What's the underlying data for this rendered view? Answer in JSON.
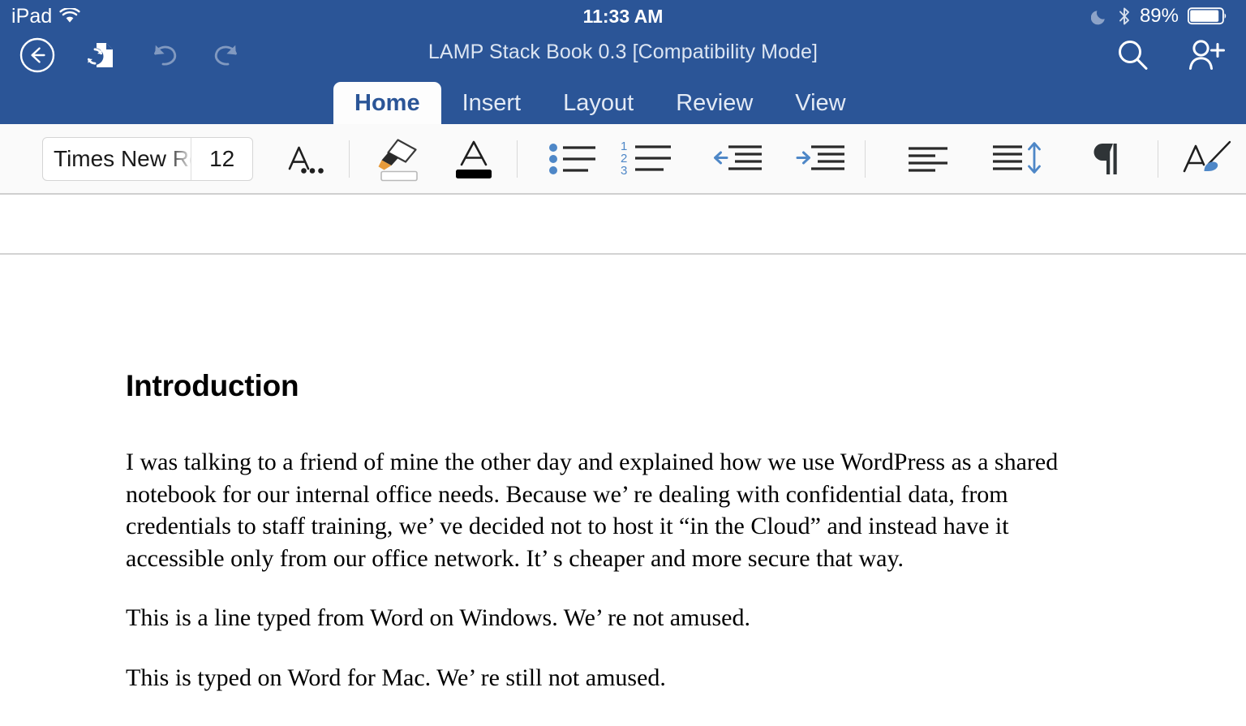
{
  "status_bar": {
    "device_label": "iPad",
    "wifi_icon": "wifi-icon",
    "time": "11:33 AM",
    "dnd_icon": "moon-icon",
    "bluetooth_icon": "bluetooth-icon",
    "battery_percent": "89%",
    "battery_icon": "battery-icon"
  },
  "title_bar": {
    "document_title": "LAMP Stack Book 0.3 [Compatibility Mode]",
    "left_buttons": [
      {
        "name": "back-button",
        "icon": "back-arrow-circle-icon",
        "enabled": true
      },
      {
        "name": "save-sync-button",
        "icon": "file-sync-icon",
        "enabled": true
      },
      {
        "name": "undo-button",
        "icon": "undo-arrow-icon",
        "enabled": false
      },
      {
        "name": "redo-button",
        "icon": "redo-arrow-icon",
        "enabled": false
      }
    ],
    "right_buttons": [
      {
        "name": "search-button",
        "icon": "search-icon"
      },
      {
        "name": "share-invite-button",
        "icon": "add-person-icon"
      }
    ],
    "colors": {
      "header_blue": "#2B5597",
      "title_text": "#DCE5F2"
    }
  },
  "tabs": {
    "active": "Home",
    "items": [
      {
        "label": "Home"
      },
      {
        "label": "Insert"
      },
      {
        "label": "Layout"
      },
      {
        "label": "Review"
      },
      {
        "label": "View"
      }
    ]
  },
  "ribbon": {
    "font_name": "Times New Ro",
    "font_size": "12",
    "buttons": [
      {
        "name": "font-formatting-button",
        "icon": "font-format-a-ellipsis-icon"
      },
      {
        "name": "highlight-color-button",
        "icon": "highlighter-pen-icon",
        "swatch": "#FFFFFF"
      },
      {
        "name": "font-color-button",
        "icon": "font-color-a-icon",
        "swatch": "#000000"
      },
      {
        "name": "bulleted-list-button",
        "icon": "bullet-list-icon"
      },
      {
        "name": "numbered-list-button",
        "icon": "numbered-list-icon"
      },
      {
        "name": "decrease-indent-button",
        "icon": "decrease-indent-icon"
      },
      {
        "name": "increase-indent-button",
        "icon": "increase-indent-icon"
      },
      {
        "name": "align-left-button",
        "icon": "align-left-icon"
      },
      {
        "name": "line-spacing-button",
        "icon": "line-spacing-icon"
      },
      {
        "name": "show-formatting-marks-button",
        "icon": "pilcrow-icon"
      },
      {
        "name": "styles-button",
        "icon": "styles-brush-icon"
      }
    ],
    "colors": {
      "background": "#FAFAFA",
      "accent_blue": "#5B8FD1"
    }
  },
  "document": {
    "heading": "Introduction",
    "paragraphs": [
      "I was talking to a friend of mine the other day and explained how we use WordPress as a shared notebook for our internal office needs. Because we’ re dealing with confidential data, from credentials to staff training, we’ ve decided not to host it “in the Cloud” and instead have it accessible only from our office network. It’ s cheaper and more secure that way.",
      "This is a line typed from Word on Windows. We’ re not amused.",
      "This is typed on Word for Mac. We’ re still not amused."
    ]
  }
}
